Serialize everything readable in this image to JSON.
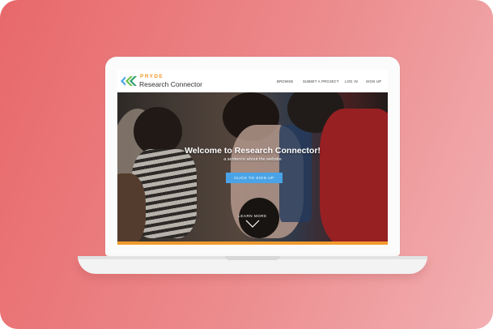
{
  "site": {
    "brand_top": "PRYDE",
    "brand_bottom": "Research Connector",
    "nav": [
      {
        "label": "BROWSE"
      },
      {
        "label": "SUBMIT A PROJECT"
      },
      {
        "label": "LOG IN"
      },
      {
        "label": "SIGN UP"
      }
    ]
  },
  "hero": {
    "title": "Welcome to Research Connector!",
    "subtitle": "a sentence about the website",
    "cta_label": "CLICK TO SIGN UP",
    "learn_more": "LEARN MORE"
  },
  "colors": {
    "accent_orange": "#f29a2e",
    "cta_blue": "#4aa3e6",
    "background_gradient_start": "#e8686a",
    "background_gradient_end": "#f2b0b2"
  },
  "icons": {
    "logo": "pryde-chevron-logo",
    "scroll": "chevron-down-icon"
  }
}
